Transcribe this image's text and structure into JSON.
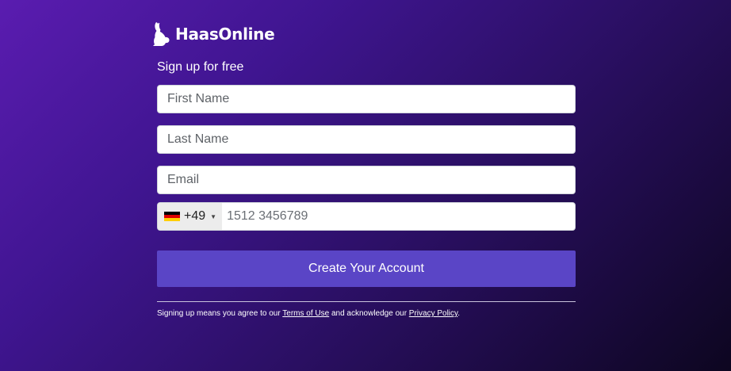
{
  "brand": {
    "name": "HaasOnline",
    "logo_icon": "rabbit-icon"
  },
  "form": {
    "heading": "Sign up for free",
    "first_name_placeholder": "First Name",
    "last_name_placeholder": "Last Name",
    "email_placeholder": "Email",
    "phone": {
      "country_flag": "germany-flag-icon",
      "dial_code": "+49",
      "placeholder": "1512 3456789"
    },
    "submit_label": "Create Your Account"
  },
  "legal": {
    "prefix": "Signing up means you agree to our ",
    "terms_link": "Terms of Use",
    "middle": " and acknowledge our ",
    "privacy_link": "Privacy Policy",
    "suffix": "."
  },
  "colors": {
    "button": "#5a45c6",
    "background_start": "#5a1cb0",
    "background_end": "#0d0620"
  }
}
